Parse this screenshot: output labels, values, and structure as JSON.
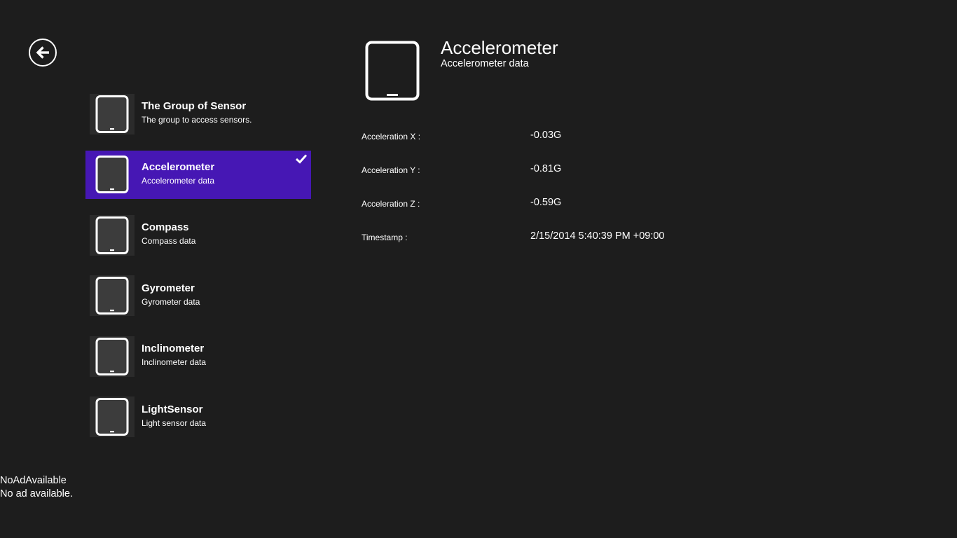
{
  "back_button": {
    "icon": "arrow-left-icon"
  },
  "sensors": [
    {
      "name": "The Group of Sensor",
      "desc": "The group to access sensors.",
      "icon": "tablet-icon",
      "selected": false
    },
    {
      "name": "Accelerometer",
      "desc": "Accelerometer data",
      "icon": "tablet-icon",
      "selected": true
    },
    {
      "name": "Compass",
      "desc": "Compass data",
      "icon": "tablet-icon",
      "selected": false
    },
    {
      "name": "Gyrometer",
      "desc": "Gyrometer data",
      "icon": "tablet-icon",
      "selected": false
    },
    {
      "name": "Inclinometer",
      "desc": "Inclinometer data",
      "icon": "tablet-icon",
      "selected": false
    },
    {
      "name": "LightSensor",
      "desc": "Light sensor data",
      "icon": "tablet-icon",
      "selected": false
    }
  ],
  "detail": {
    "title": "Accelerometer",
    "subtitle": "Accelerometer data",
    "icon": "tablet-icon",
    "readings": [
      {
        "label": "Acceleration X :",
        "value": "-0.03G"
      },
      {
        "label": "Acceleration Y :",
        "value": "-0.81G"
      },
      {
        "label": "Acceleration Z :",
        "value": "-0.59G"
      },
      {
        "label": "Timestamp :",
        "value": "2/15/2014 5:40:39 PM +09:00"
      }
    ]
  },
  "ad": {
    "line1": "NoAdAvailable",
    "line2": "No ad available."
  },
  "colors": {
    "background": "#1d1d1d",
    "accent": "#4617b4",
    "tile": "#2b2b2b",
    "screen": "#3c3c3c",
    "text": "#ffffff"
  }
}
